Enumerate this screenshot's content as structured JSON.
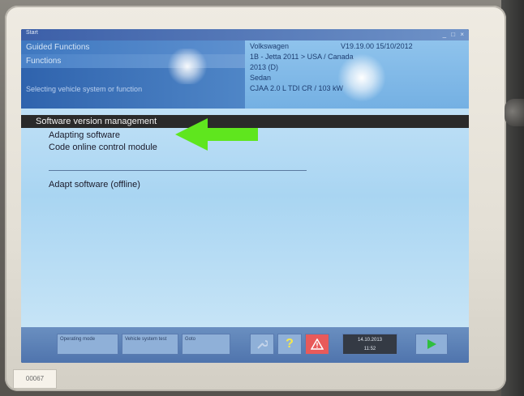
{
  "sticker": {
    "label": "00067"
  },
  "window": {
    "title": "Start",
    "controls": "_ □ ×"
  },
  "breadcrumbs": [
    "Guided Functions",
    "Functions",
    "Selecting vehicle system or function"
  ],
  "vehicle_info": {
    "make": "Volkswagen",
    "version": "V19.19.00 15/10/2012",
    "model": "1B - Jetta 2011 > USA / Canada",
    "year": "2013 (D)",
    "body": "Sedan",
    "engine": "CJAA 2.0 L TDI CR / 103 kW"
  },
  "section_title": "Software version management",
  "menu": {
    "items": [
      "Adapting software",
      "Code online control module",
      "Adapt software (offline)"
    ]
  },
  "toolbar": {
    "buttons": [
      "Operating mode",
      "Vehicle system test",
      "Goto"
    ],
    "icons": [
      "wrench-icon",
      "help-icon",
      "warning-icon",
      "play-icon"
    ],
    "datetime": [
      "14.10.2013",
      "11:52"
    ]
  },
  "colors": {
    "header_blue": "#3f78c0",
    "content_blue": "#b6dbf4",
    "arrow_green": "#5fe61e",
    "section_bg": "#2a2a2a"
  }
}
